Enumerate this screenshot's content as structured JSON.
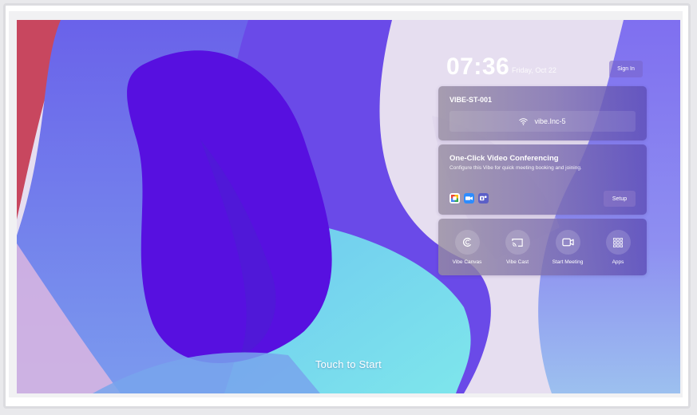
{
  "lock_screen": {
    "time": "07:36",
    "date": "Friday, Oct 22",
    "sign_in_label": "Sign In",
    "touch_prompt": "Touch to Start"
  },
  "device_card": {
    "device_name": "VIBE-ST-001",
    "network_name": "vibe.Inc-5",
    "network_icon": "wifi-icon"
  },
  "conferencing_card": {
    "title": "One-Click Video Conferencing",
    "description": "Configure this Vibe for quick meeting booking and joining.",
    "setup_label": "Setup",
    "services": [
      {
        "icon": "google-meet-icon",
        "color": "#34a853"
      },
      {
        "icon": "zoom-icon",
        "color": "#2d8cff"
      },
      {
        "icon": "teams-icon",
        "color": "#5b5fc7"
      }
    ]
  },
  "quick_actions": [
    {
      "label": "Vibe Canvas",
      "icon": "canvas-icon"
    },
    {
      "label": "Vibe Cast",
      "icon": "cast-icon"
    },
    {
      "label": "Start Meeting",
      "icon": "video-camera-icon"
    },
    {
      "label": "Apps",
      "icon": "apps-grid-icon"
    }
  ],
  "colors": {
    "accent": "#5b2ee6",
    "card_tint": "#7d6eb4"
  }
}
